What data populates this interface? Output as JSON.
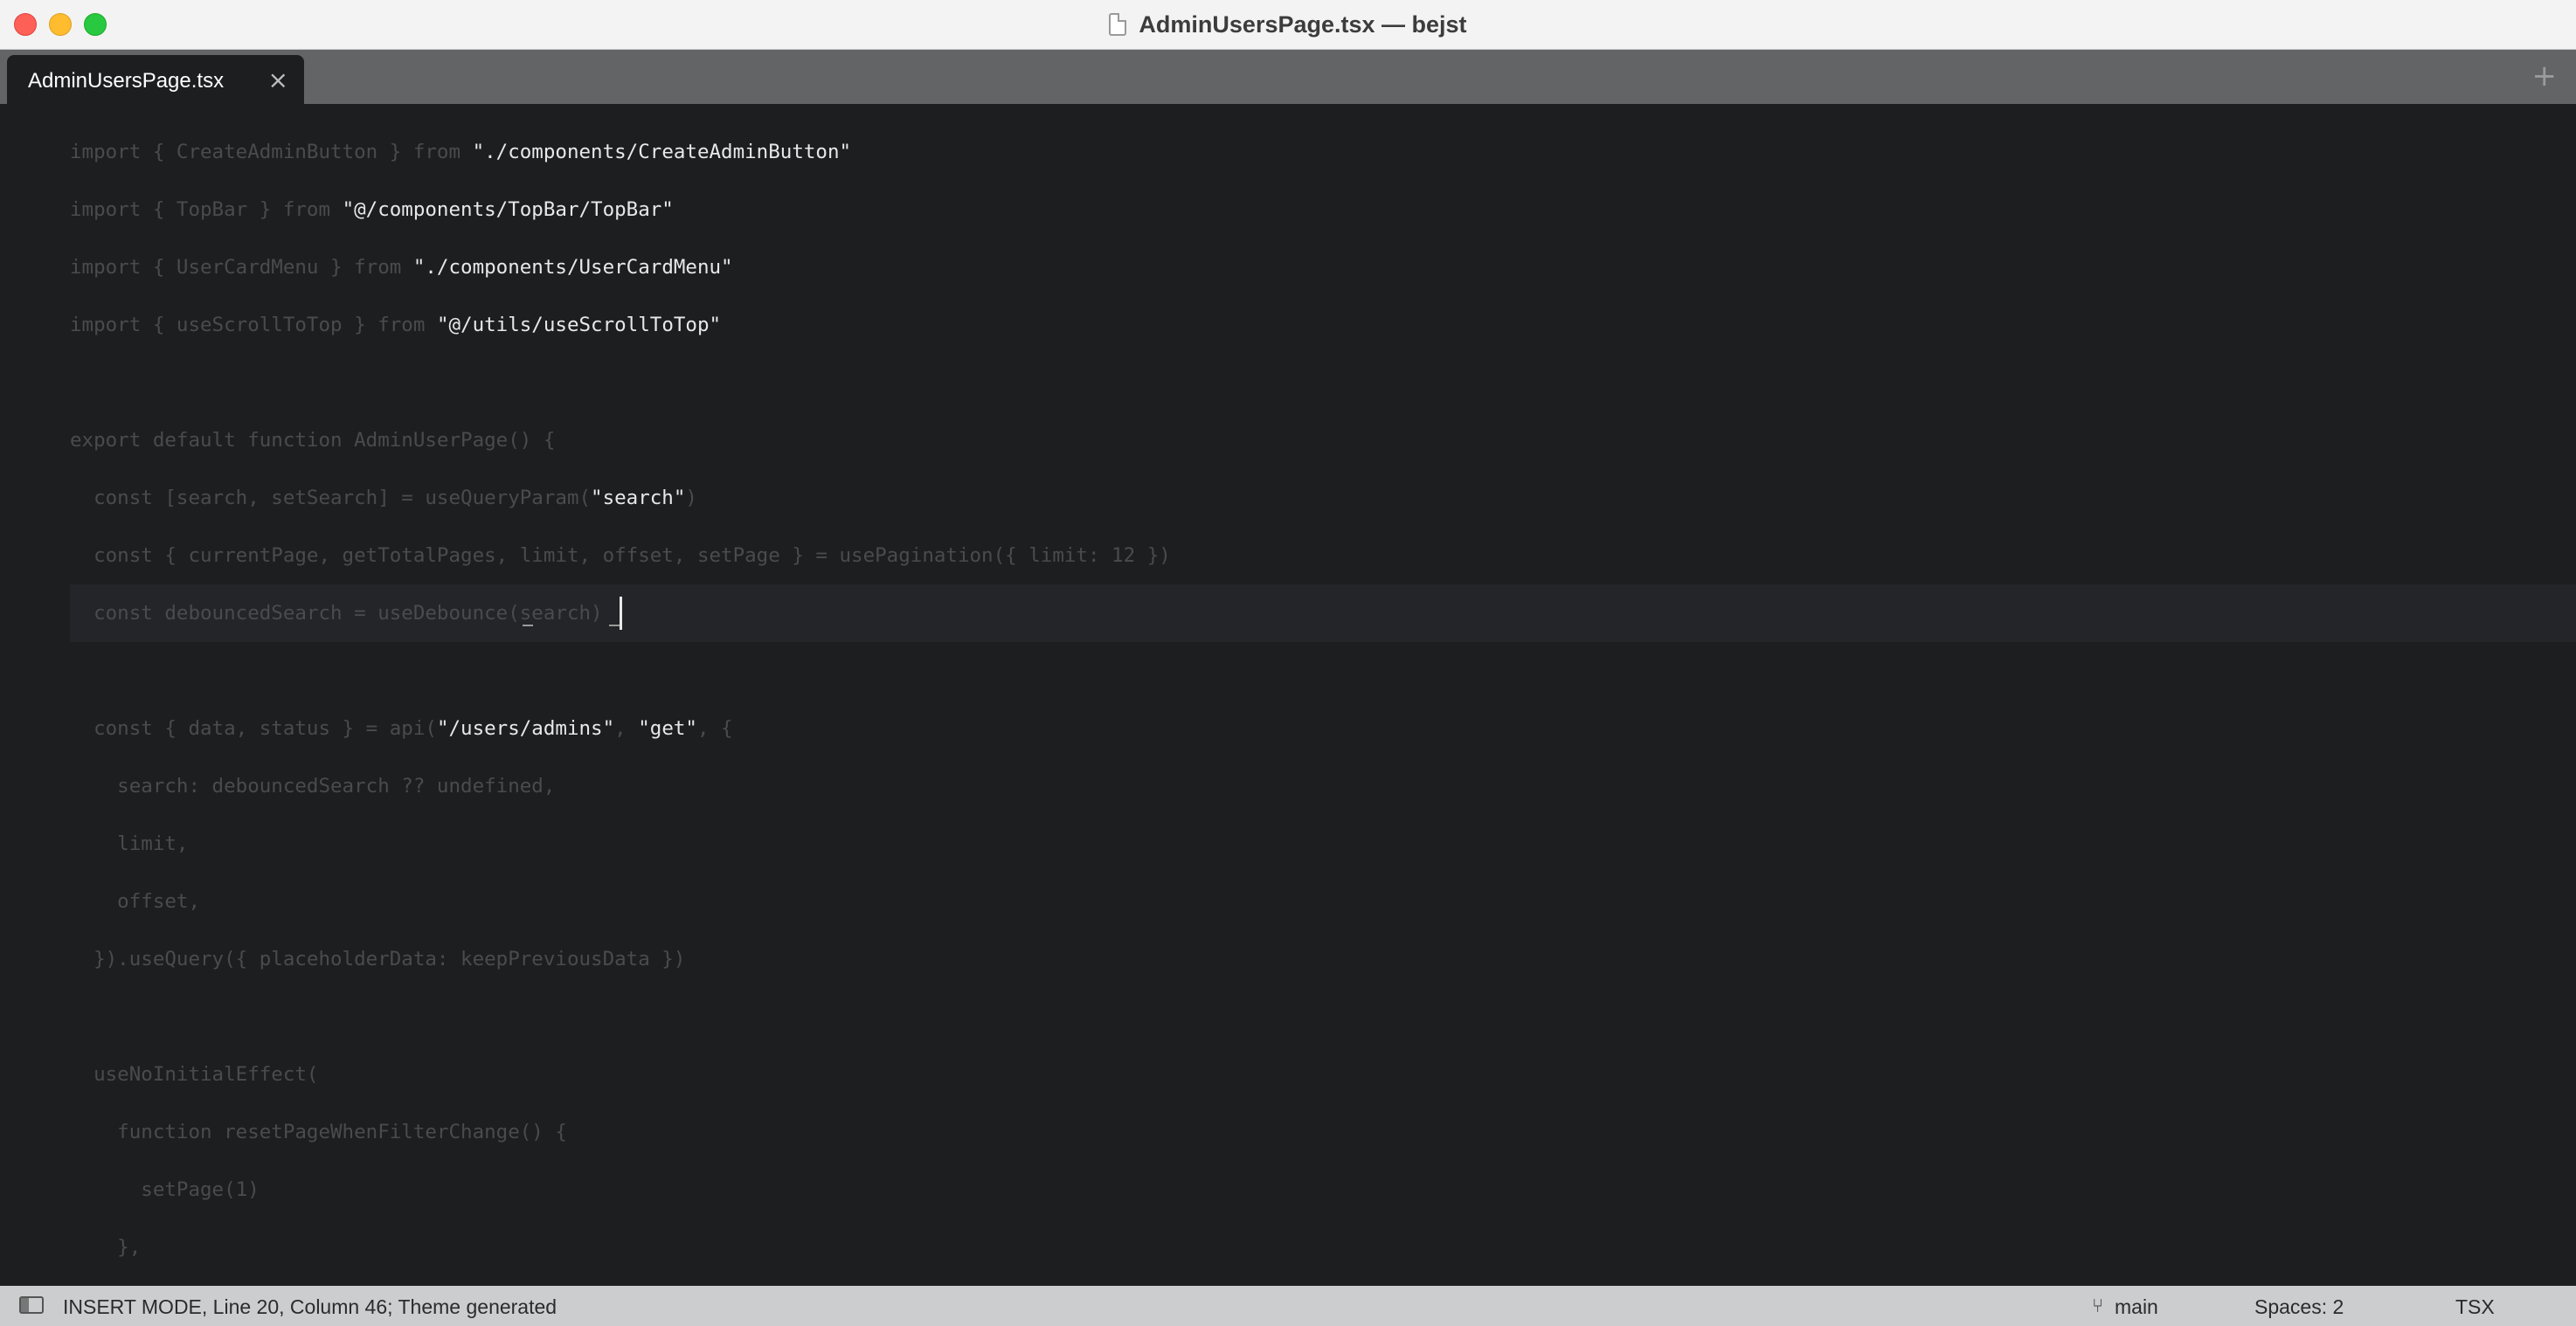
{
  "window": {
    "title": "AdminUsersPage.tsx — bejst"
  },
  "tabs": [
    {
      "label": "AdminUsersPage.tsx",
      "close_glyph": "×"
    }
  ],
  "new_tab_glyph": "+",
  "editor": {
    "lines": [
      {
        "dim": "import { CreateAdminButton } from ",
        "str": "\"./components/CreateAdminButton\"",
        "rest": ""
      },
      {
        "dim": "import { TopBar } from ",
        "str": "\"@/components/TopBar/TopBar\"",
        "rest": ""
      },
      {
        "dim": "import { UserCardMenu } from ",
        "str": "\"./components/UserCardMenu\"",
        "rest": ""
      },
      {
        "dim": "import { useScrollToTop } from ",
        "str": "\"@/utils/useScrollToTop\"",
        "rest": ""
      },
      {
        "dim": "",
        "str": "",
        "rest": ""
      },
      {
        "dim": "export default function AdminUserPage() {",
        "str": "",
        "rest": ""
      },
      {
        "dim": "  const [search, setSearch] = useQueryParam(",
        "str": "\"search\"",
        "rest": ")"
      },
      {
        "dim": "  const { currentPage, getTotalPages, limit, offset, setPage } = usePagination({ limit: 12 })",
        "str": "",
        "rest": ""
      },
      {
        "dim": "  const debouncedSearch = useDebounce(search)",
        "str": "",
        "rest": ""
      },
      {
        "dim": "",
        "str": "",
        "rest": ""
      },
      {
        "dim": "  const { data, status } = api(",
        "str": "\"/users/admins\"",
        "rest": ", ",
        "str2": "\"get\"",
        "rest2": ", {"
      },
      {
        "dim": "    search: debouncedSearch ?? undefined,",
        "str": "",
        "rest": ""
      },
      {
        "dim": "    limit,",
        "str": "",
        "rest": ""
      },
      {
        "dim": "    offset,",
        "str": "",
        "rest": ""
      },
      {
        "dim": "  }).useQuery({ placeholderData: keepPreviousData })",
        "str": "",
        "rest": ""
      },
      {
        "dim": "",
        "str": "",
        "rest": ""
      },
      {
        "dim": "  useNoInitialEffect(",
        "str": "",
        "rest": ""
      },
      {
        "dim": "    function resetPageWhenFilterChange() {",
        "str": "",
        "rest": ""
      },
      {
        "dim": "      setPage(1)",
        "str": "",
        "rest": ""
      },
      {
        "dim": "    },",
        "str": "",
        "rest": ""
      }
    ]
  },
  "status": {
    "mode": "INSERT MODE, Line 20, Column 46; Theme generated",
    "branch": "main",
    "spaces": "Spaces: 2",
    "language": "TSX",
    "branch_icon": "git-branch-icon",
    "sidebar_icon": "sidebar-toggle-icon"
  },
  "colors": {
    "editor_bg": "#1d1e20",
    "dim_text": "#4a4b4e",
    "string_text": "#e8e8e8",
    "tab_bar": "#636466",
    "status_bar": "#cccdcf"
  }
}
